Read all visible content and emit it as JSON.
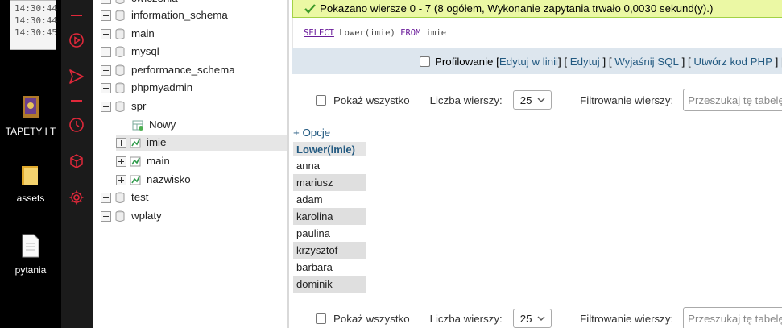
{
  "desktop": {
    "log_lines": [
      "14:30:44",
      "14:30:44",
      "14:30:45"
    ],
    "icons": [
      {
        "label": "TAPETY I T",
        "icon": "folder-image-icon"
      },
      {
        "label": "assets",
        "icon": "folder-icon"
      },
      {
        "label": "pytania",
        "icon": "document-icon"
      }
    ]
  },
  "appbar": {
    "icons": [
      "play-circle-icon",
      "send-icon",
      "clock-icon",
      "cube-icon",
      "gear-icon"
    ],
    "accent": "#e0283a"
  },
  "nav": {
    "partial_top": "ćwiczenia",
    "databases": [
      {
        "label": "information_schema",
        "expanded": false
      },
      {
        "label": "main",
        "expanded": false
      },
      {
        "label": "mysql",
        "expanded": false
      },
      {
        "label": "performance_schema",
        "expanded": false
      },
      {
        "label": "phpmyadmin",
        "expanded": false
      },
      {
        "label": "spr",
        "expanded": true
      }
    ],
    "spr_children": [
      {
        "label": "Nowy",
        "type": "new"
      },
      {
        "label": "imie",
        "type": "table",
        "selected": true
      },
      {
        "label": "main",
        "type": "table"
      },
      {
        "label": "nazwisko",
        "type": "table"
      }
    ],
    "after": [
      {
        "label": "test"
      },
      {
        "label": "wplaty"
      }
    ]
  },
  "main": {
    "success_message": "Pokazano wiersze 0 - 7 (8 ogółem, Wykonanie zapytania trwało 0,0030 sekund(y).)",
    "query": {
      "select": "SELECT",
      "fn": "Lower(imie)",
      "from": "FROM",
      "table": "imie"
    },
    "sqlbar": {
      "profiling": "Profilowanie",
      "edit_inline": "Edytuj w linii",
      "edit": "Edytuj",
      "explain": "Wyjaśnij SQL",
      "create_php": "Utwórz kod PHP"
    },
    "controls": {
      "show_all": "Pokaż wszystko",
      "rows_label": "Liczba wierszy:",
      "rows_value": "25",
      "filter_label": "Filtrowanie wierszy:",
      "filter_placeholder": "Przeszukaj tę tabelę"
    },
    "options_link": "+ Opcje",
    "result": {
      "column": "Lower(imie)",
      "rows": [
        "anna",
        "mariusz",
        "adam",
        "karolina",
        "paulina",
        "krzysztof",
        "barbara",
        "dominik"
      ]
    }
  }
}
